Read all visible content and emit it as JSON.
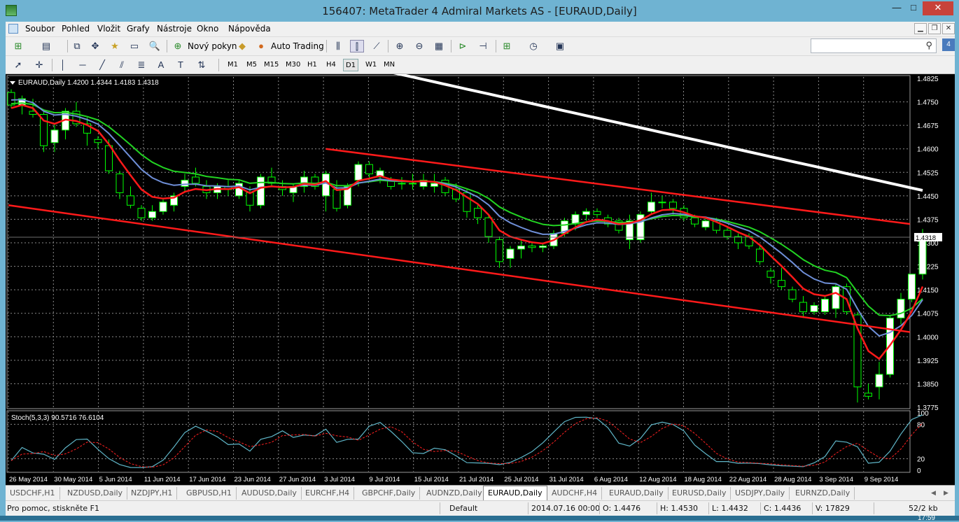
{
  "window": {
    "title": "156407: MetaTrader 4 Admiral Markets AS - [EURAUD,Daily]",
    "minimize": "—",
    "maximize": "□",
    "close": "✕"
  },
  "menu": {
    "items": [
      "Soubor",
      "Pohled",
      "Vložit",
      "Grafy",
      "Nástroje",
      "Okno",
      "Nápověda"
    ]
  },
  "toolbar": {
    "new_order_label": "Nový pokyn",
    "auto_trading_label": "Auto Trading",
    "timeframes": [
      "M1",
      "M5",
      "M15",
      "M30",
      "H1",
      "H4",
      "D1",
      "W1",
      "MN"
    ],
    "active_timeframe": "D1",
    "search_value": "",
    "message_count": "4"
  },
  "chart": {
    "header": "EURAUD,Daily  1.4200 1.4344 1.4183 1.4318",
    "current_price_label": "1.4318",
    "stoch_header": "Stoch(5,3,3) 90.5716 76.6104",
    "colors": {
      "background": "#000000",
      "grid": "#8a8a8a",
      "bull_candle": "#ffffff",
      "bear_candle": "#000000",
      "candle_outline": "#00ff00",
      "ma_red": "#ff1a1a",
      "ma_blue": "#6f8fd8",
      "ma_green": "#22d322",
      "ma_white": "#ffffff",
      "trendline": "#ff1a1a",
      "stoch_main": "#5fb6c8",
      "stoch_signal": "#ff2020"
    }
  },
  "chart_data": {
    "type": "candlestick",
    "symbol": "EURAUD",
    "timeframe": "Daily",
    "ylim": [
      1.3775,
      1.4825
    ],
    "yticks": [
      "1.4825",
      "1.4750",
      "1.4675",
      "1.4600",
      "1.4525",
      "1.4450",
      "1.4375",
      "1.4300",
      "1.4225",
      "1.4150",
      "1.4075",
      "1.4000",
      "1.3925",
      "1.3850",
      "1.3775"
    ],
    "xticks": [
      "26 May 2014",
      "30 May 2014",
      "5 Jun 2014",
      "11 Jun 2014",
      "17 Jun 2014",
      "23 Jun 2014",
      "27 Jun 2014",
      "3 Jul 2014",
      "9 Jul 2014",
      "15 Jul 2014",
      "21 Jul 2014",
      "25 Jul 2014",
      "31 Jul 2014",
      "6 Aug 2014",
      "12 Aug 2014",
      "18 Aug 2014",
      "22 Aug 2014",
      "28 Aug 2014",
      "3 Sep 2014",
      "9 Sep 2014"
    ],
    "candles": [
      [
        1.478,
        1.479,
        1.473,
        1.474
      ],
      [
        1.474,
        1.477,
        1.471,
        1.476
      ],
      [
        1.472,
        1.476,
        1.47,
        1.471
      ],
      [
        1.471,
        1.472,
        1.459,
        1.461
      ],
      [
        1.462,
        1.468,
        1.459,
        1.466
      ],
      [
        1.466,
        1.473,
        1.463,
        1.472
      ],
      [
        1.472,
        1.475,
        1.467,
        1.468
      ],
      [
        1.468,
        1.47,
        1.461,
        1.465
      ],
      [
        1.463,
        1.464,
        1.46,
        1.462
      ],
      [
        1.461,
        1.463,
        1.452,
        1.453
      ],
      [
        1.452,
        1.453,
        1.444,
        1.446
      ],
      [
        1.445,
        1.448,
        1.441,
        1.442
      ],
      [
        1.441,
        1.442,
        1.437,
        1.438
      ],
      [
        1.438,
        1.442,
        1.437,
        1.44
      ],
      [
        1.44,
        1.444,
        1.439,
        1.443
      ],
      [
        1.442,
        1.446,
        1.44,
        1.445
      ],
      [
        1.448,
        1.452,
        1.446,
        1.45
      ],
      [
        1.451,
        1.454,
        1.448,
        1.449
      ],
      [
        1.448,
        1.45,
        1.444,
        1.446
      ],
      [
        1.446,
        1.449,
        1.444,
        1.448
      ],
      [
        1.448,
        1.45,
        1.445,
        1.447
      ],
      [
        1.445,
        1.45,
        1.444,
        1.449
      ],
      [
        1.446,
        1.448,
        1.44,
        1.442
      ],
      [
        1.442,
        1.452,
        1.441,
        1.451
      ],
      [
        1.451,
        1.454,
        1.448,
        1.449
      ],
      [
        1.448,
        1.45,
        1.445,
        1.447
      ],
      [
        1.446,
        1.449,
        1.443,
        1.448
      ],
      [
        1.448,
        1.453,
        1.446,
        1.451
      ],
      [
        1.451,
        1.452,
        1.447,
        1.448
      ],
      [
        1.445,
        1.453,
        1.44,
        1.452
      ],
      [
        1.447,
        1.45,
        1.44,
        1.441
      ],
      [
        1.442,
        1.449,
        1.441,
        1.448
      ],
      [
        1.45,
        1.456,
        1.448,
        1.455
      ],
      [
        1.455,
        1.456,
        1.45,
        1.452
      ],
      [
        1.451,
        1.454,
        1.449,
        1.453
      ],
      [
        1.45,
        1.451,
        1.447,
        1.448
      ],
      [
        1.449,
        1.451,
        1.447,
        1.449
      ],
      [
        1.449,
        1.452,
        1.447,
        1.449
      ],
      [
        1.448,
        1.452,
        1.447,
        1.45
      ],
      [
        1.448,
        1.452,
        1.446,
        1.449
      ],
      [
        1.45,
        1.451,
        1.445,
        1.446
      ],
      [
        1.447,
        1.449,
        1.443,
        1.444
      ],
      [
        1.446,
        1.447,
        1.438,
        1.44
      ],
      [
        1.441,
        1.442,
        1.436,
        1.438
      ],
      [
        1.438,
        1.439,
        1.43,
        1.432
      ],
      [
        1.431,
        1.432,
        1.422,
        1.424
      ],
      [
        1.425,
        1.429,
        1.422,
        1.428
      ],
      [
        1.428,
        1.431,
        1.425,
        1.429
      ],
      [
        1.429,
        1.43,
        1.427,
        1.4285
      ],
      [
        1.4285,
        1.43,
        1.427,
        1.429
      ],
      [
        1.429,
        1.434,
        1.428,
        1.433
      ],
      [
        1.433,
        1.438,
        1.432,
        1.437
      ],
      [
        1.436,
        1.44,
        1.434,
        1.439
      ],
      [
        1.439,
        1.441,
        1.437,
        1.44
      ],
      [
        1.44,
        1.441,
        1.438,
        1.439
      ],
      [
        1.438,
        1.439,
        1.435,
        1.436
      ],
      [
        1.437,
        1.438,
        1.433,
        1.434
      ],
      [
        1.431,
        1.439,
        1.428,
        1.437
      ],
      [
        1.431,
        1.44,
        1.43,
        1.439
      ],
      [
        1.44,
        1.446,
        1.439,
        1.443
      ],
      [
        1.443,
        1.445,
        1.441,
        1.443
      ],
      [
        1.443,
        1.444,
        1.439,
        1.441
      ],
      [
        1.441,
        1.442,
        1.437,
        1.438
      ],
      [
        1.438,
        1.439,
        1.435,
        1.436
      ],
      [
        1.435,
        1.438,
        1.434,
        1.437
      ],
      [
        1.437,
        1.438,
        1.433,
        1.434
      ],
      [
        1.434,
        1.435,
        1.431,
        1.432
      ],
      [
        1.432,
        1.433,
        1.428,
        1.43
      ],
      [
        1.432,
        1.433,
        1.428,
        1.429
      ],
      [
        1.428,
        1.429,
        1.423,
        1.424
      ],
      [
        1.421,
        1.422,
        1.417,
        1.419
      ],
      [
        1.418,
        1.422,
        1.415,
        1.416
      ],
      [
        1.415,
        1.416,
        1.411,
        1.412
      ],
      [
        1.411,
        1.413,
        1.406,
        1.408
      ],
      [
        1.408,
        1.411,
        1.407,
        1.41
      ],
      [
        1.408,
        1.413,
        1.407,
        1.412
      ],
      [
        1.409,
        1.417,
        1.406,
        1.416
      ],
      [
        1.416,
        1.417,
        1.407,
        1.408
      ],
      [
        1.407,
        1.408,
        1.379,
        1.384
      ],
      [
        1.382,
        1.385,
        1.38,
        1.381
      ],
      [
        1.384,
        1.392,
        1.38,
        1.388
      ],
      [
        1.388,
        1.407,
        1.387,
        1.406
      ],
      [
        1.406,
        1.414,
        1.404,
        1.412
      ],
      [
        1.412,
        1.42,
        1.411,
        1.42
      ],
      [
        1.42,
        1.4344,
        1.4183,
        1.4318
      ]
    ],
    "stochastic": {
      "params": "5,3,3",
      "main_last": 90.5716,
      "signal_last": 76.6104,
      "levels": [
        20,
        80
      ]
    }
  },
  "tabs": {
    "items": [
      "USDCHF,H1",
      "NZDUSD,Daily",
      "NZDJPY,H1",
      "GBPUSD,H1",
      "AUDUSD,Daily",
      "EURCHF,H4",
      "GBPCHF,Daily",
      "AUDNZD,Daily",
      "EURAUD,Daily",
      "AUDCHF,H4",
      "EURAUD,Daily",
      "EURUSD,Daily",
      "USDJPY,Daily",
      "EURNZD,Daily"
    ],
    "active_index": 8
  },
  "status": {
    "help": "Pro pomoc, stiskněte F1",
    "profile": "Default",
    "datetime": "2014.07.16 00:00",
    "open": "O: 1.4476",
    "high": "H: 1.4530",
    "low": "L: 1.4432",
    "close": "C: 1.4436",
    "volume": "V: 17829",
    "traffic": "52/2 kb"
  },
  "taskbar": {
    "clock": "17:59"
  }
}
